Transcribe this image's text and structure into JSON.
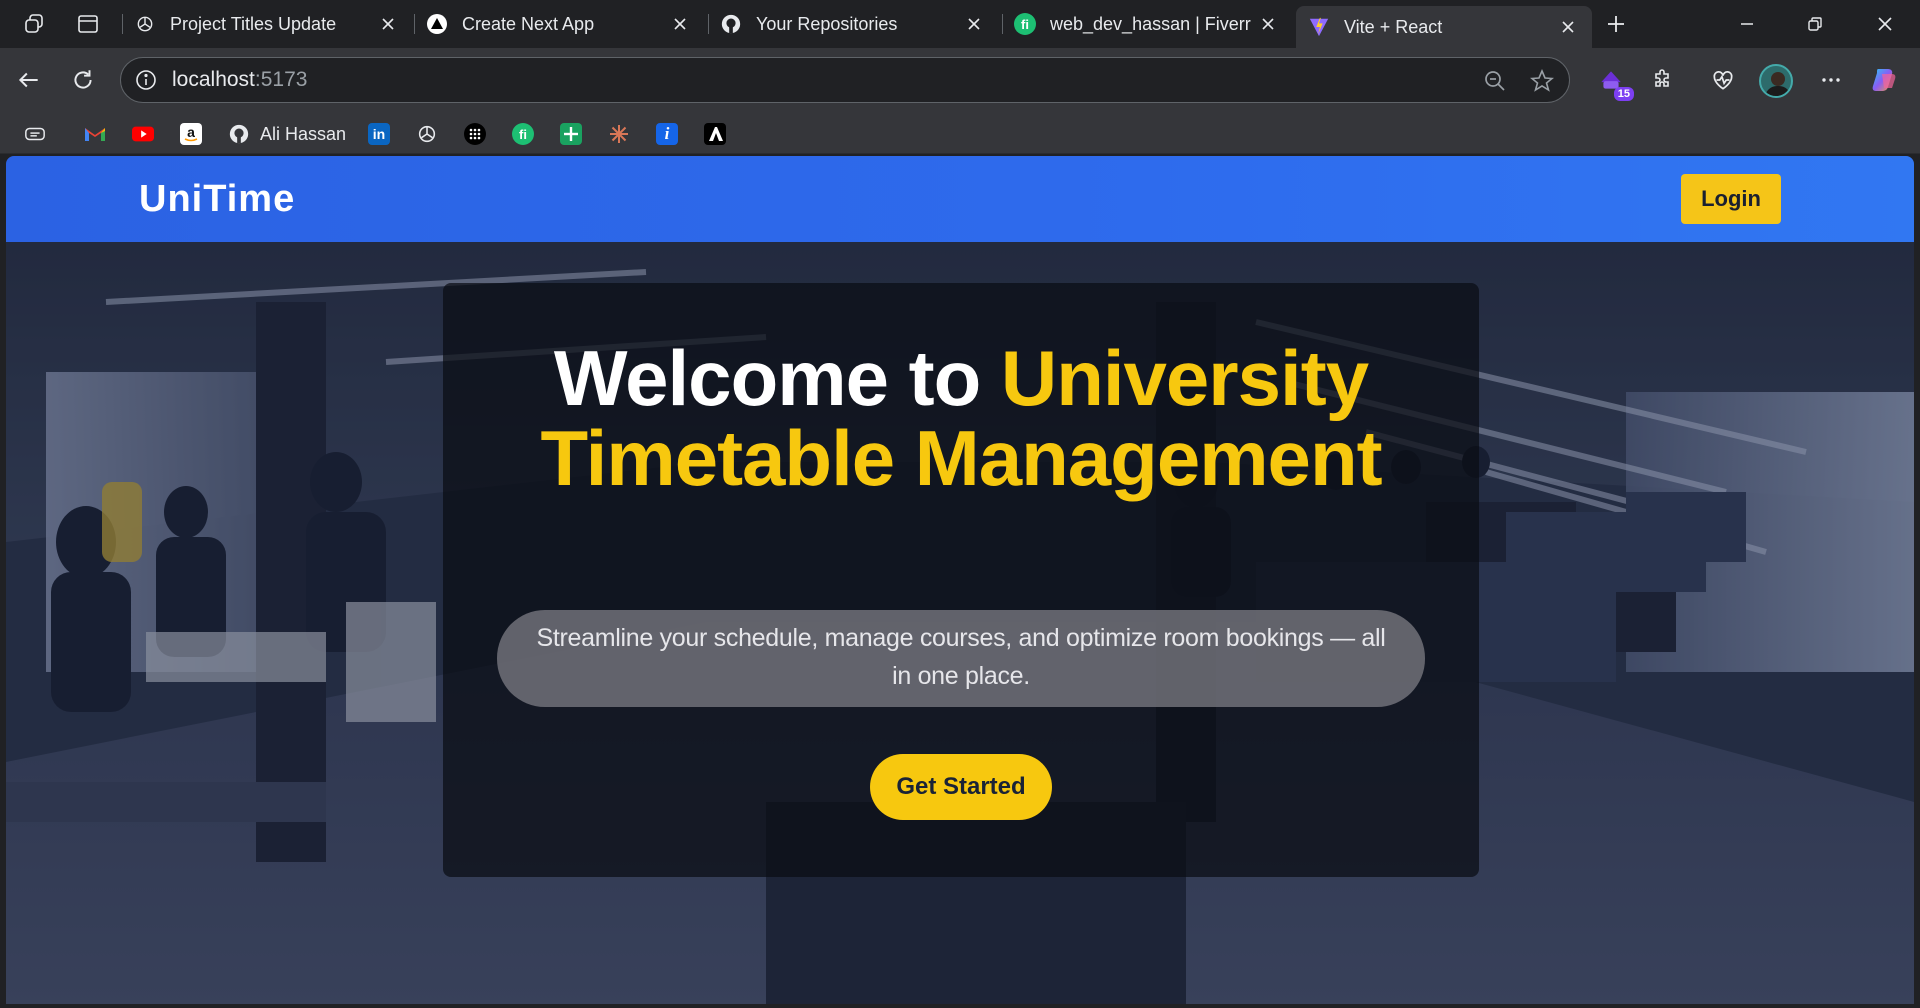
{
  "browser": {
    "tabs": [
      {
        "title": "Project Titles Update",
        "icon": "openai-icon"
      },
      {
        "title": "Create Next App",
        "icon": "triangle-icon"
      },
      {
        "title": "Your Repositories",
        "icon": "github-icon"
      },
      {
        "title": "web_dev_hassan | Fiverr",
        "icon": "fiverr-icon"
      },
      {
        "title": "Vite + React",
        "icon": "vite-icon",
        "active": true
      }
    ],
    "address": {
      "host": "localhost",
      "port": ":5173"
    },
    "extension_badge": "15",
    "bookmarks": [
      {
        "name": "ali-hassan",
        "label": "Ali Hassan"
      }
    ]
  },
  "page": {
    "brand": "UniTime",
    "login_label": "Login",
    "hero": {
      "headline_white": "Welcome to ",
      "headline_yellow": "University Timetable Management",
      "subtitle": "Streamline your schedule, manage courses, and optimize room bookings — all in one place.",
      "cta_label": "Get Started"
    }
  },
  "colors": {
    "navbar": "#2e6bed",
    "accent_yellow": "#f7c80f",
    "chrome_dark": "#202124",
    "chrome_toolbar": "#35363a"
  }
}
